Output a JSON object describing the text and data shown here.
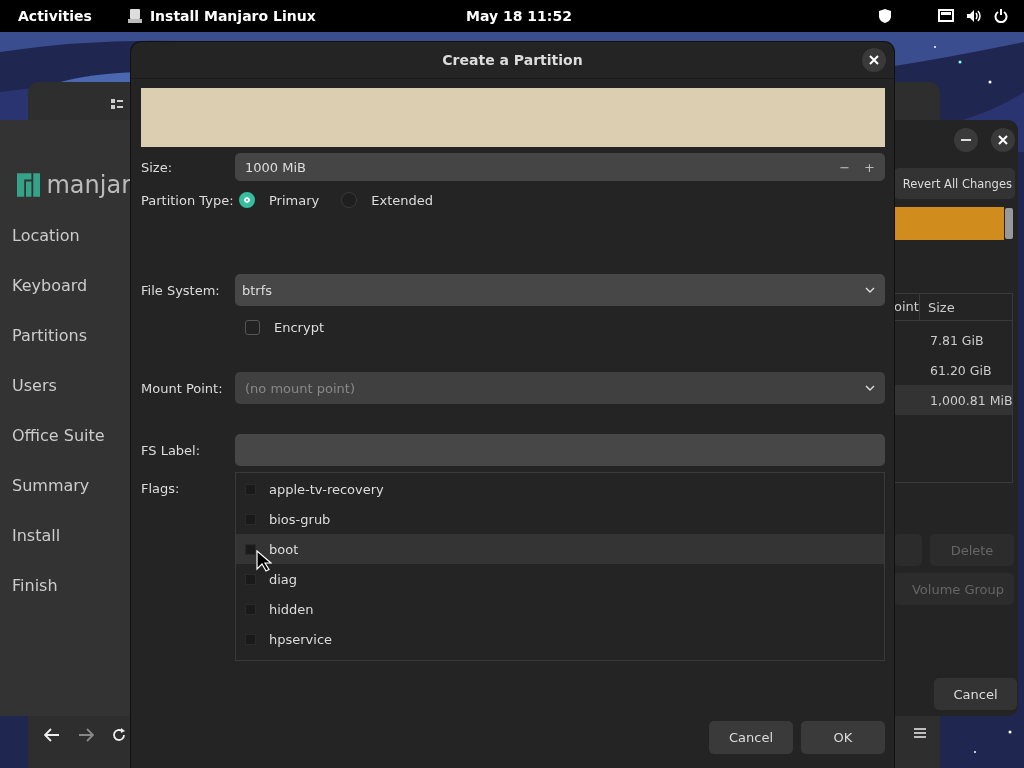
{
  "top_bar": {
    "activities": "Activities",
    "app_title": "Install Manjaro Linux",
    "clock": "May 18  11:52"
  },
  "installer": {
    "logo_text": "manjar",
    "sidebar": {
      "items": [
        {
          "label": "Location"
        },
        {
          "label": "Keyboard"
        },
        {
          "label": "Partitions"
        },
        {
          "label": "Users"
        },
        {
          "label": "Office Suite"
        },
        {
          "label": "Summary"
        },
        {
          "label": "Install"
        },
        {
          "label": "Finish"
        }
      ]
    },
    "revert_button": "Revert All Changes",
    "table": {
      "columns": [
        "oint",
        "Size"
      ],
      "rows": [
        {
          "size": "7.81 GiB",
          "selected": false
        },
        {
          "size": "61.20 GiB",
          "selected": false
        },
        {
          "size": "1,000.81 MiB",
          "selected": true
        }
      ]
    },
    "buttons": [
      {
        "label": "Delete",
        "disabled": true
      },
      {
        "label": "Volume Group",
        "disabled": true
      },
      {
        "label": "Cancel",
        "disabled": false
      }
    ]
  },
  "dialog": {
    "title": "Create a Partition",
    "size": {
      "label": "Size:",
      "value": "1000 MiB",
      "decrement": "−",
      "increment": "+"
    },
    "partition_type": {
      "label": "Partition Type:",
      "options": [
        {
          "label": "Primary",
          "selected": true
        },
        {
          "label": "Extended",
          "selected": false
        }
      ]
    },
    "file_system": {
      "label": "File System:",
      "value": "btrfs"
    },
    "encrypt": {
      "label": "Encrypt",
      "checked": false
    },
    "mount_point": {
      "label": "Mount Point:",
      "placeholder": "(no mount point)"
    },
    "fs_label": {
      "label": "FS Label:"
    },
    "flags": {
      "label": "Flags:",
      "items": [
        {
          "label": "apple-tv-recovery",
          "checked": false,
          "hovered": false
        },
        {
          "label": "bios-grub",
          "checked": false,
          "hovered": false
        },
        {
          "label": "boot",
          "checked": false,
          "hovered": true
        },
        {
          "label": "diag",
          "checked": false,
          "hovered": false
        },
        {
          "label": "hidden",
          "checked": false,
          "hovered": false
        },
        {
          "label": "hpservice",
          "checked": false,
          "hovered": false
        }
      ]
    },
    "buttons": [
      "Cancel",
      "OK"
    ]
  }
}
